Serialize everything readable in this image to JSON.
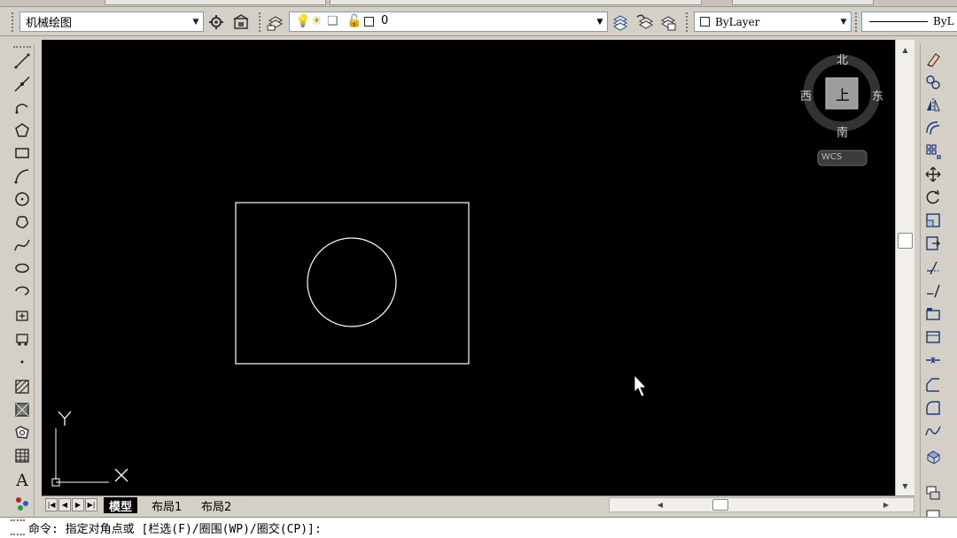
{
  "toolbar": {
    "workspace_value": "机械绘图",
    "layer_value": "0",
    "color_value": "ByLayer",
    "linetype_value": "ByL"
  },
  "viewcube": {
    "north": "北",
    "south": "南",
    "east": "东",
    "west": "西",
    "face": "上",
    "wcs_label": "WCS"
  },
  "ucs": {
    "y_label": "Y",
    "x_label": "X"
  },
  "tabs": [
    {
      "label": "模型"
    },
    {
      "label": "布局1"
    },
    {
      "label": "布局2"
    }
  ],
  "command_line": {
    "text": "命令: 指定对角点或 [栏选(F)/圈围(WP)/圈交(CP)]:"
  },
  "colors": {
    "canvas_bg": "#000000",
    "drawing_stroke": "#ffffff",
    "ui_bg": "#d4d0c8"
  },
  "icons": {
    "left_toolbar": [
      "line-icon",
      "construction-line-icon",
      "polyline-icon",
      "polygon-icon",
      "rectangle-icon",
      "arc-icon",
      "circle-icon",
      "revision-cloud-icon",
      "spline-icon",
      "ellipse-icon",
      "ellipse-arc-icon",
      "insert-block-icon",
      "make-block-icon",
      "point-icon",
      "hatch-icon",
      "gradient-icon",
      "region-icon",
      "table-icon",
      "multiline-text-icon",
      "add-selected-icon"
    ],
    "right_toolbar": [
      "erase-icon",
      "copy-icon",
      "mirror-icon",
      "offset-icon",
      "array-icon",
      "move-icon",
      "rotate-icon",
      "scale-icon",
      "stretch-icon",
      "trim-icon",
      "extend-icon",
      "break-at-point-icon",
      "break-icon",
      "join-icon",
      "chamfer-icon",
      "fillet-icon",
      "blend-curves-icon",
      "explode-icon",
      "draworder-icon"
    ]
  }
}
